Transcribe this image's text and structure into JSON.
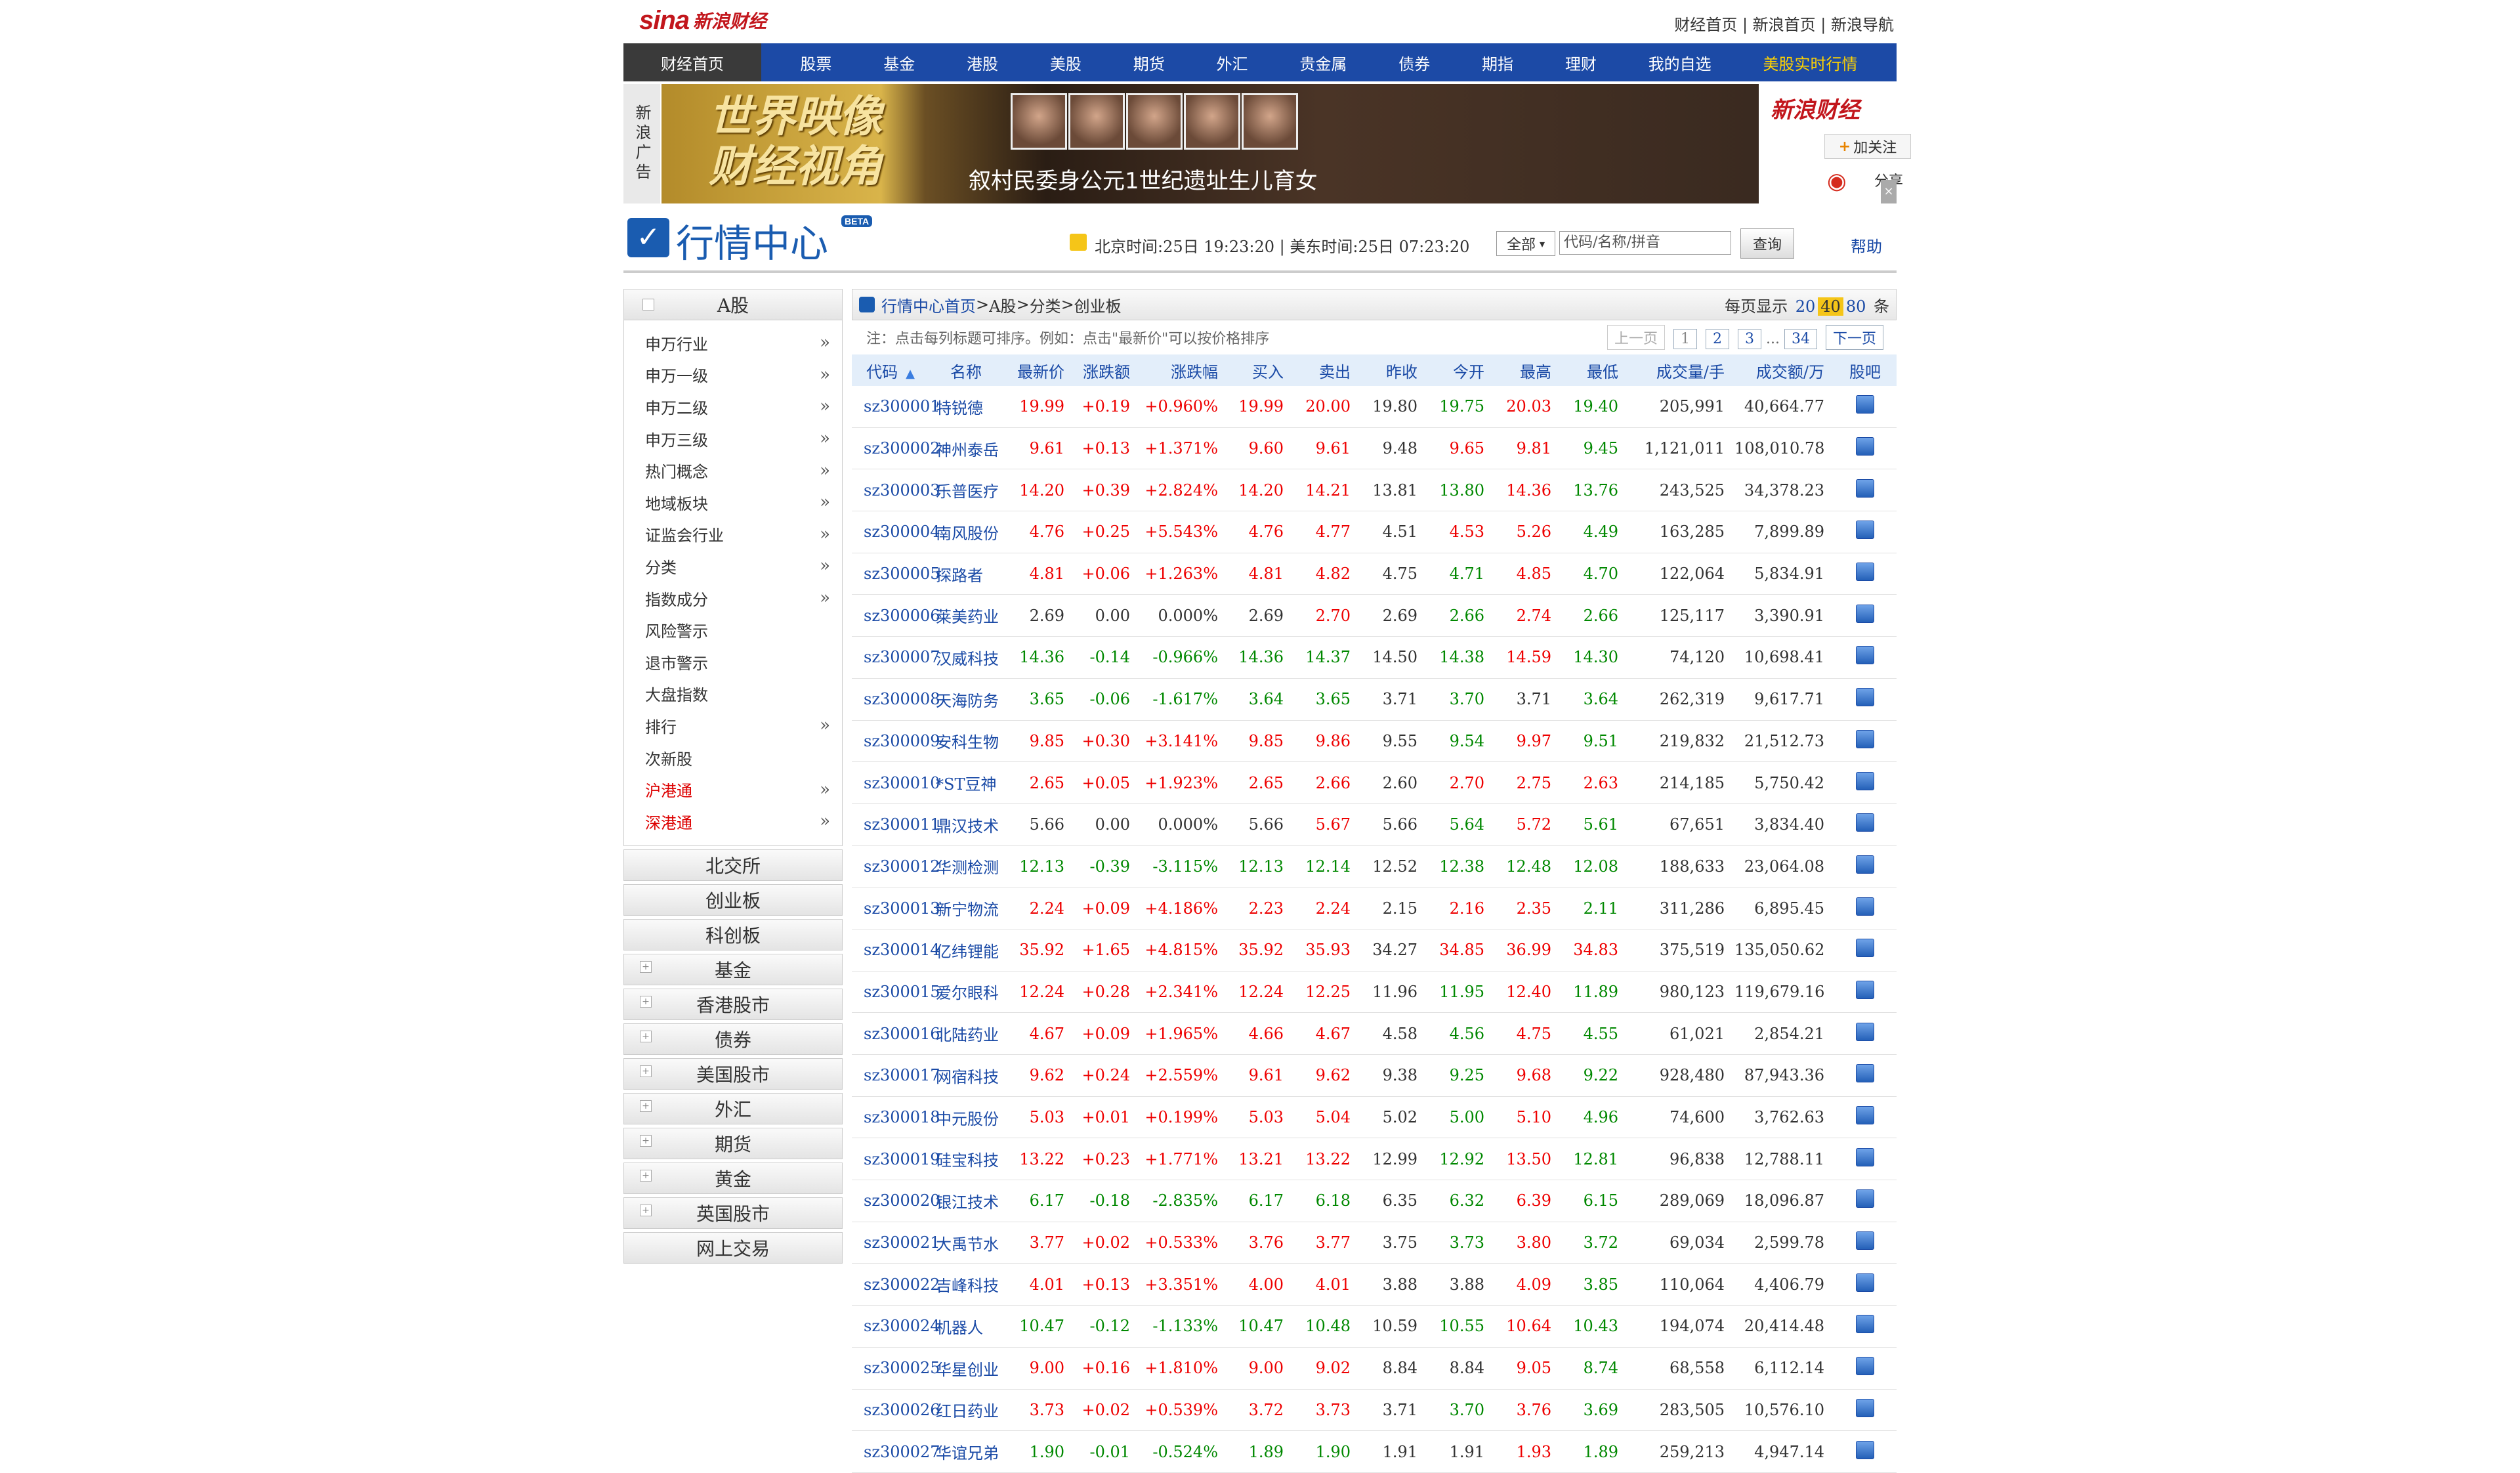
{
  "brand": {
    "logo_en": "sina",
    "logo_cn": "新浪财经"
  },
  "top_links": [
    "财经首页",
    "新浪首页",
    "新浪导航"
  ],
  "nav": {
    "home": "财经首页",
    "items": [
      "股票",
      "基金",
      "港股",
      "美股",
      "期货",
      "外汇",
      "贵金属",
      "债券",
      "期指",
      "理财",
      "我的自选"
    ],
    "highlight": "美股实时行情"
  },
  "ad": {
    "label": "新浪广告",
    "title_line1": "世界映像",
    "title_line2": "财经视角",
    "caption": "叙村民委身公元1世纪遗址生儿育女",
    "brand": "新浪财经",
    "follow": "加关注",
    "share": "分享"
  },
  "market_center": {
    "title": "行情中心",
    "beta": "BETA",
    "time": "北京时间:25日 19:23:20 | 美东时间:25日 07:23:20",
    "select": "全部",
    "search_placeholder": "代码/名称/拼音",
    "search_btn": "查询",
    "help": "帮助"
  },
  "sidebar": {
    "title": "A股",
    "items": [
      {
        "label": "申万行业",
        "arrow": true,
        "red": false
      },
      {
        "label": "申万一级",
        "arrow": true,
        "red": false
      },
      {
        "label": "申万二级",
        "arrow": true,
        "red": false
      },
      {
        "label": "申万三级",
        "arrow": true,
        "red": false
      },
      {
        "label": "热门概念",
        "arrow": true,
        "red": false
      },
      {
        "label": "地域板块",
        "arrow": true,
        "red": false
      },
      {
        "label": "证监会行业",
        "arrow": true,
        "red": false
      },
      {
        "label": "分类",
        "arrow": true,
        "red": false
      },
      {
        "label": "指数成分",
        "arrow": true,
        "red": false
      },
      {
        "label": "风险警示",
        "arrow": false,
        "red": false
      },
      {
        "label": "退市警示",
        "arrow": false,
        "red": false
      },
      {
        "label": "大盘指数",
        "arrow": false,
        "red": false
      },
      {
        "label": "排行",
        "arrow": true,
        "red": false
      },
      {
        "label": "次新股",
        "arrow": false,
        "red": false
      },
      {
        "label": "沪港通",
        "arrow": true,
        "red": true
      },
      {
        "label": "深港通",
        "arrow": true,
        "red": true
      }
    ],
    "categories": [
      {
        "label": "北交所",
        "plus": false
      },
      {
        "label": "创业板",
        "plus": false
      },
      {
        "label": "科创板",
        "plus": false
      },
      {
        "label": "基金",
        "plus": true
      },
      {
        "label": "香港股市",
        "plus": true
      },
      {
        "label": "债券",
        "plus": true
      },
      {
        "label": "美国股市",
        "plus": true
      },
      {
        "label": "外汇",
        "plus": true
      },
      {
        "label": "期货",
        "plus": true
      },
      {
        "label": "黄金",
        "plus": true
      },
      {
        "label": "英国股市",
        "plus": true
      },
      {
        "label": "网上交易",
        "plus": false
      }
    ]
  },
  "breadcrumb": {
    "home": "行情中心首页",
    "sep": " > ",
    "path": [
      "A股",
      "分类",
      "创业板"
    ]
  },
  "per_page": {
    "label": "每页显示",
    "options": [
      "20",
      "40",
      "80"
    ],
    "selected": "40",
    "unit": "条"
  },
  "note": "注：点击每列标题可排序。例如：点击\"最新价\"可以按价格排序",
  "pagination": {
    "prev": "上一页",
    "pages": [
      "1",
      "2",
      "3"
    ],
    "ellipsis": "...",
    "last": "34",
    "next": "下一页"
  },
  "table": {
    "headers": [
      "代码",
      "名称",
      "最新价",
      "涨跌额",
      "涨跌幅",
      "买入",
      "卖出",
      "昨收",
      "今开",
      "最高",
      "最低",
      "成交量/手",
      "成交额/万",
      "股吧"
    ],
    "rows": [
      [
        "sz300001",
        "特锐德",
        "19.99",
        "+0.19",
        "+0.960%",
        "19.99",
        "20.00",
        "19.80",
        "19.75",
        "20.03",
        "19.40",
        "205,991",
        "40,664.77"
      ],
      [
        "sz300002",
        "神州泰岳",
        "9.61",
        "+0.13",
        "+1.371%",
        "9.60",
        "9.61",
        "9.48",
        "9.65",
        "9.81",
        "9.45",
        "1,121,011",
        "108,010.78"
      ],
      [
        "sz300003",
        "乐普医疗",
        "14.20",
        "+0.39",
        "+2.824%",
        "14.20",
        "14.21",
        "13.81",
        "13.80",
        "14.36",
        "13.76",
        "243,525",
        "34,378.23"
      ],
      [
        "sz300004",
        "南风股份",
        "4.76",
        "+0.25",
        "+5.543%",
        "4.76",
        "4.77",
        "4.51",
        "4.53",
        "5.26",
        "4.49",
        "163,285",
        "7,899.89"
      ],
      [
        "sz300005",
        "探路者",
        "4.81",
        "+0.06",
        "+1.263%",
        "4.81",
        "4.82",
        "4.75",
        "4.71",
        "4.85",
        "4.70",
        "122,064",
        "5,834.91"
      ],
      [
        "sz300006",
        "莱美药业",
        "2.69",
        "0.00",
        "0.000%",
        "2.69",
        "2.70",
        "2.69",
        "2.66",
        "2.74",
        "2.66",
        "125,117",
        "3,390.91"
      ],
      [
        "sz300007",
        "汉威科技",
        "14.36",
        "-0.14",
        "-0.966%",
        "14.36",
        "14.37",
        "14.50",
        "14.38",
        "14.59",
        "14.30",
        "74,120",
        "10,698.41"
      ],
      [
        "sz300008",
        "天海防务",
        "3.65",
        "-0.06",
        "-1.617%",
        "3.64",
        "3.65",
        "3.71",
        "3.70",
        "3.71",
        "3.64",
        "262,319",
        "9,617.71"
      ],
      [
        "sz300009",
        "安科生物",
        "9.85",
        "+0.30",
        "+3.141%",
        "9.85",
        "9.86",
        "9.55",
        "9.54",
        "9.97",
        "9.51",
        "219,832",
        "21,512.73"
      ],
      [
        "sz300010",
        "*ST豆神",
        "2.65",
        "+0.05",
        "+1.923%",
        "2.65",
        "2.66",
        "2.60",
        "2.70",
        "2.75",
        "2.63",
        "214,185",
        "5,750.42"
      ],
      [
        "sz300011",
        "鼎汉技术",
        "5.66",
        "0.00",
        "0.000%",
        "5.66",
        "5.67",
        "5.66",
        "5.64",
        "5.72",
        "5.61",
        "67,651",
        "3,834.40"
      ],
      [
        "sz300012",
        "华测检测",
        "12.13",
        "-0.39",
        "-3.115%",
        "12.13",
        "12.14",
        "12.52",
        "12.38",
        "12.48",
        "12.08",
        "188,633",
        "23,064.08"
      ],
      [
        "sz300013",
        "新宁物流",
        "2.24",
        "+0.09",
        "+4.186%",
        "2.23",
        "2.24",
        "2.15",
        "2.16",
        "2.35",
        "2.11",
        "311,286",
        "6,895.45"
      ],
      [
        "sz300014",
        "亿纬锂能",
        "35.92",
        "+1.65",
        "+4.815%",
        "35.92",
        "35.93",
        "34.27",
        "34.85",
        "36.99",
        "34.83",
        "375,519",
        "135,050.62"
      ],
      [
        "sz300015",
        "爱尔眼科",
        "12.24",
        "+0.28",
        "+2.341%",
        "12.24",
        "12.25",
        "11.96",
        "11.95",
        "12.40",
        "11.89",
        "980,123",
        "119,679.16"
      ],
      [
        "sz300016",
        "北陆药业",
        "4.67",
        "+0.09",
        "+1.965%",
        "4.66",
        "4.67",
        "4.58",
        "4.56",
        "4.75",
        "4.55",
        "61,021",
        "2,854.21"
      ],
      [
        "sz300017",
        "网宿科技",
        "9.62",
        "+0.24",
        "+2.559%",
        "9.61",
        "9.62",
        "9.38",
        "9.25",
        "9.68",
        "9.22",
        "928,480",
        "87,943.36"
      ],
      [
        "sz300018",
        "中元股份",
        "5.03",
        "+0.01",
        "+0.199%",
        "5.03",
        "5.04",
        "5.02",
        "5.00",
        "5.10",
        "4.96",
        "74,600",
        "3,762.63"
      ],
      [
        "sz300019",
        "硅宝科技",
        "13.22",
        "+0.23",
        "+1.771%",
        "13.21",
        "13.22",
        "12.99",
        "12.92",
        "13.50",
        "12.81",
        "96,838",
        "12,788.11"
      ],
      [
        "sz300020",
        "银江技术",
        "6.17",
        "-0.18",
        "-2.835%",
        "6.17",
        "6.18",
        "6.35",
        "6.32",
        "6.39",
        "6.15",
        "289,069",
        "18,096.87"
      ],
      [
        "sz300021",
        "大禹节水",
        "3.77",
        "+0.02",
        "+0.533%",
        "3.76",
        "3.77",
        "3.75",
        "3.73",
        "3.80",
        "3.72",
        "69,034",
        "2,599.78"
      ],
      [
        "sz300022",
        "吉峰科技",
        "4.01",
        "+0.13",
        "+3.351%",
        "4.00",
        "4.01",
        "3.88",
        "3.88",
        "4.09",
        "3.85",
        "110,064",
        "4,406.79"
      ],
      [
        "sz300024",
        "机器人",
        "10.47",
        "-0.12",
        "-1.133%",
        "10.47",
        "10.48",
        "10.59",
        "10.55",
        "10.64",
        "10.43",
        "194,074",
        "20,414.48"
      ],
      [
        "sz300025",
        "华星创业",
        "9.00",
        "+0.16",
        "+1.810%",
        "9.00",
        "9.02",
        "8.84",
        "8.84",
        "9.05",
        "8.74",
        "68,558",
        "6,112.14"
      ],
      [
        "sz300026",
        "红日药业",
        "3.73",
        "+0.02",
        "+0.539%",
        "3.72",
        "3.73",
        "3.71",
        "3.70",
        "3.76",
        "3.69",
        "283,505",
        "10,576.10"
      ],
      [
        "sz300027",
        "华谊兄弟",
        "1.90",
        "-0.01",
        "-0.524%",
        "1.89",
        "1.90",
        "1.91",
        "1.91",
        "1.93",
        "1.89",
        "259,213",
        "4,947.14"
      ]
    ]
  },
  "colors": {
    "up": "#e00000",
    "down": "#008000",
    "nav": "#1c4aa6",
    "link": "#1a4aa6",
    "highlight": "#ffd200"
  }
}
